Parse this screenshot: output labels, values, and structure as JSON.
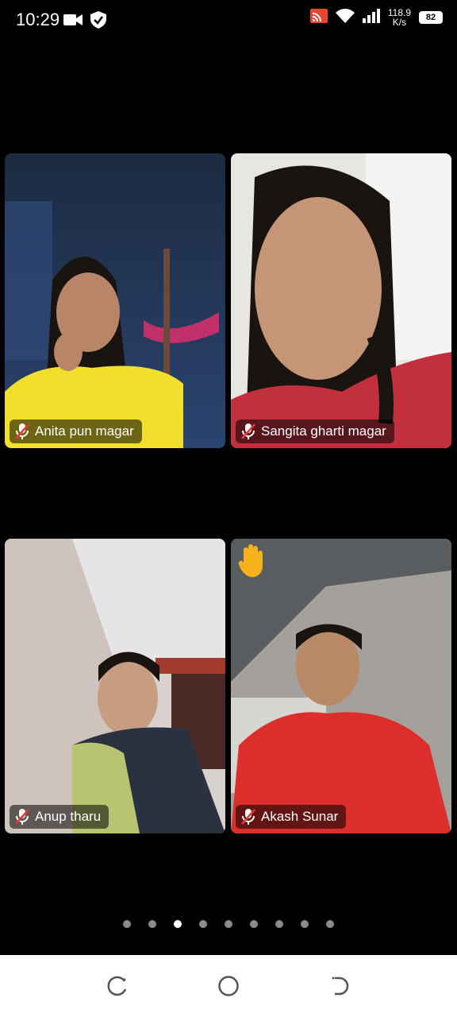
{
  "status_bar": {
    "time": "10:29",
    "speed_value": "118.9",
    "speed_unit": "K/s",
    "battery": "82",
    "icons": [
      "video-camera-icon",
      "shield-check-icon",
      "cast-icon",
      "wifi-icon",
      "signal-icon",
      "battery-icon"
    ]
  },
  "participants": [
    {
      "name": "Anita pun magar",
      "muted": true,
      "hand_raised": false
    },
    {
      "name": "Sangita gharti magar",
      "muted": true,
      "hand_raised": false
    },
    {
      "name": "Anup tharu",
      "muted": true,
      "hand_raised": false
    },
    {
      "name": "Akash Sunar",
      "muted": true,
      "hand_raised": true
    }
  ],
  "pagination": {
    "pages": 9,
    "current": 3
  },
  "nav": {
    "icons": [
      "recents-icon",
      "home-icon",
      "back-icon"
    ]
  },
  "colors": {
    "background": "#000000",
    "nav_bar": "#ffffff",
    "hand": "#f5b21a",
    "mute_red": "#e53935"
  }
}
